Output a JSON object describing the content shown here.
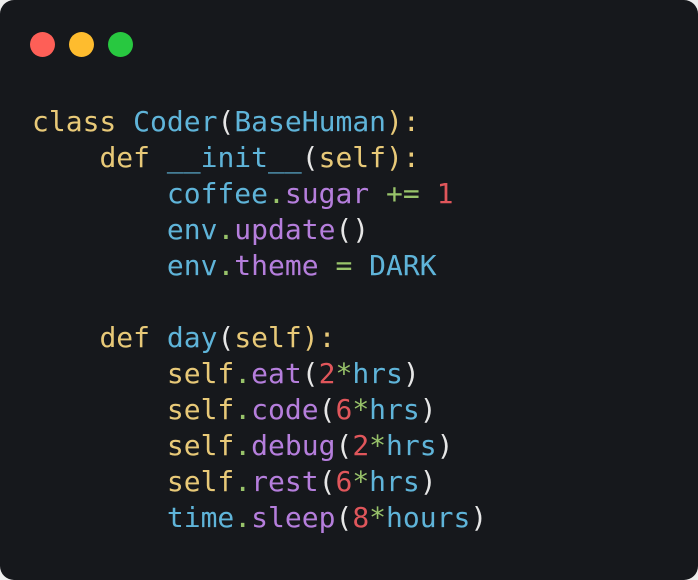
{
  "window": {
    "controls": [
      {
        "name": "close",
        "color": "#fe5f57"
      },
      {
        "name": "minimize",
        "color": "#febc2e"
      },
      {
        "name": "maximize",
        "color": "#28c840"
      }
    ]
  },
  "code": {
    "lines": [
      [
        {
          "t": "class",
          "k": "keyword"
        },
        {
          "t": " ",
          "k": "punc"
        },
        {
          "t": "Coder",
          "k": "class"
        },
        {
          "t": "(",
          "k": "punc"
        },
        {
          "t": "BaseHuman",
          "k": "class"
        },
        {
          "t": "):",
          "k": "keyword"
        }
      ],
      [
        {
          "t": "    ",
          "k": "punc"
        },
        {
          "t": "def",
          "k": "keyword"
        },
        {
          "t": " ",
          "k": "punc"
        },
        {
          "t": "__init__",
          "k": "name"
        },
        {
          "t": "(",
          "k": "punc"
        },
        {
          "t": "self",
          "k": "self"
        },
        {
          "t": "):",
          "k": "keyword"
        }
      ],
      [
        {
          "t": "        ",
          "k": "punc"
        },
        {
          "t": "coffee",
          "k": "name"
        },
        {
          "t": ".",
          "k": "op"
        },
        {
          "t": "sugar",
          "k": "attr"
        },
        {
          "t": " ",
          "k": "punc"
        },
        {
          "t": "+=",
          "k": "op"
        },
        {
          "t": " ",
          "k": "punc"
        },
        {
          "t": "1",
          "k": "number"
        }
      ],
      [
        {
          "t": "        ",
          "k": "punc"
        },
        {
          "t": "env",
          "k": "name"
        },
        {
          "t": ".",
          "k": "op"
        },
        {
          "t": "update",
          "k": "attr"
        },
        {
          "t": "()",
          "k": "punc"
        }
      ],
      [
        {
          "t": "        ",
          "k": "punc"
        },
        {
          "t": "env",
          "k": "name"
        },
        {
          "t": ".",
          "k": "op"
        },
        {
          "t": "theme",
          "k": "attr"
        },
        {
          "t": " ",
          "k": "punc"
        },
        {
          "t": "=",
          "k": "op"
        },
        {
          "t": " ",
          "k": "punc"
        },
        {
          "t": "DARK",
          "k": "const"
        }
      ],
      [],
      [
        {
          "t": "    ",
          "k": "punc"
        },
        {
          "t": "def",
          "k": "keyword"
        },
        {
          "t": " ",
          "k": "punc"
        },
        {
          "t": "day",
          "k": "name"
        },
        {
          "t": "(",
          "k": "punc"
        },
        {
          "t": "self",
          "k": "self"
        },
        {
          "t": "):",
          "k": "keyword"
        }
      ],
      [
        {
          "t": "        ",
          "k": "punc"
        },
        {
          "t": "self",
          "k": "self"
        },
        {
          "t": ".",
          "k": "op"
        },
        {
          "t": "eat",
          "k": "attr"
        },
        {
          "t": "(",
          "k": "punc"
        },
        {
          "t": "2",
          "k": "number"
        },
        {
          "t": "*",
          "k": "op"
        },
        {
          "t": "hrs",
          "k": "name"
        },
        {
          "t": ")",
          "k": "punc"
        }
      ],
      [
        {
          "t": "        ",
          "k": "punc"
        },
        {
          "t": "self",
          "k": "self"
        },
        {
          "t": ".",
          "k": "op"
        },
        {
          "t": "code",
          "k": "attr"
        },
        {
          "t": "(",
          "k": "punc"
        },
        {
          "t": "6",
          "k": "number"
        },
        {
          "t": "*",
          "k": "op"
        },
        {
          "t": "hrs",
          "k": "name"
        },
        {
          "t": ")",
          "k": "punc"
        }
      ],
      [
        {
          "t": "        ",
          "k": "punc"
        },
        {
          "t": "self",
          "k": "self"
        },
        {
          "t": ".",
          "k": "op"
        },
        {
          "t": "debug",
          "k": "attr"
        },
        {
          "t": "(",
          "k": "punc"
        },
        {
          "t": "2",
          "k": "number"
        },
        {
          "t": "*",
          "k": "op"
        },
        {
          "t": "hrs",
          "k": "name"
        },
        {
          "t": ")",
          "k": "punc"
        }
      ],
      [
        {
          "t": "        ",
          "k": "punc"
        },
        {
          "t": "self",
          "k": "self"
        },
        {
          "t": ".",
          "k": "op"
        },
        {
          "t": "rest",
          "k": "attr"
        },
        {
          "t": "(",
          "k": "punc"
        },
        {
          "t": "6",
          "k": "number"
        },
        {
          "t": "*",
          "k": "op"
        },
        {
          "t": "hrs",
          "k": "name"
        },
        {
          "t": ")",
          "k": "punc"
        }
      ],
      [
        {
          "t": "        ",
          "k": "punc"
        },
        {
          "t": "time",
          "k": "name"
        },
        {
          "t": ".",
          "k": "op"
        },
        {
          "t": "sleep",
          "k": "attr"
        },
        {
          "t": "(",
          "k": "punc"
        },
        {
          "t": "8",
          "k": "number"
        },
        {
          "t": "*",
          "k": "op"
        },
        {
          "t": "hours",
          "k": "name"
        },
        {
          "t": ")",
          "k": "punc"
        }
      ]
    ]
  }
}
